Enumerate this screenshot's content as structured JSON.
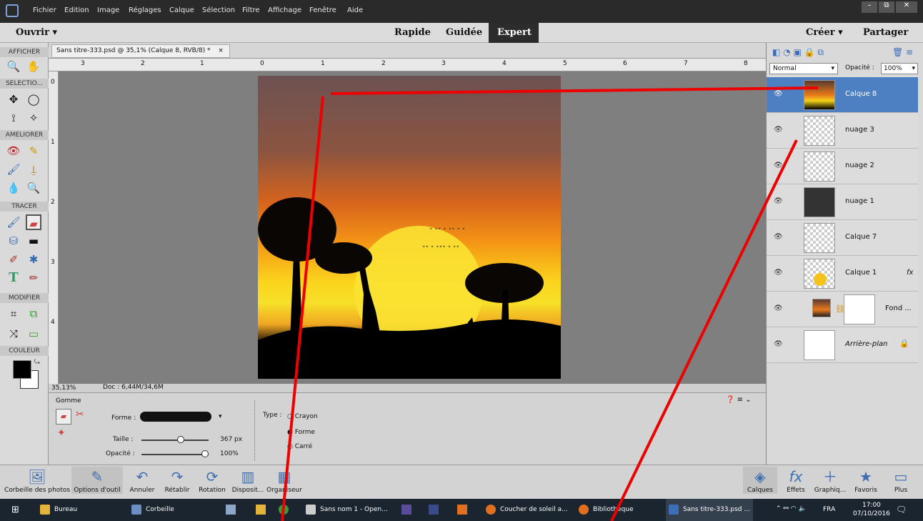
{
  "menu": {
    "items": [
      "Fichier",
      "Edition",
      "Image",
      "Réglages",
      "Calque",
      "Sélection",
      "Filtre",
      "Affichage",
      "Fenêtre",
      "Aide"
    ],
    "window_controls": [
      "–",
      "⧉",
      "✕"
    ]
  },
  "modebar": {
    "open_label": "Ouvrir",
    "modes": [
      "Rapide",
      "Guidée",
      "Expert"
    ],
    "active_mode": "Expert",
    "create_label": "Créer",
    "share_label": "Partager"
  },
  "toolbox": {
    "sections": [
      "AFFICHER",
      "SELECTIO...",
      "AMELIORER",
      "TRACER",
      "MODIFIER",
      "COULEUR"
    ]
  },
  "document": {
    "tab_title": "Sans titre-333.psd @ 35,1% (Calque 8, RVB/8) *",
    "tab_close": "×",
    "ruler_top": [
      "3",
      "2",
      "1",
      "0",
      "1",
      "2",
      "3",
      "4",
      "5",
      "6",
      "7",
      "8"
    ],
    "ruler_left": [
      "0",
      "1",
      "2",
      "3",
      "4"
    ],
    "zoom": "35,13%",
    "doc_info": "Doc : 6,44M/34,6M"
  },
  "options": {
    "tool_name": "Gomme",
    "forme_label": "Forme :",
    "taille_label": "Taille :",
    "taille_value": "367 px",
    "taille_fraction": 0.6,
    "opacite_label": "Opacité :",
    "opacite_value": "100%",
    "opacite_fraction": 1.0,
    "type_label": "Type :",
    "type_options": [
      "Crayon",
      "Forme",
      "Carré"
    ]
  },
  "layers_panel": {
    "blend_mode": "Normal",
    "opacity_label": "Opacité :",
    "opacity_value": "100%",
    "layers": [
      {
        "name": "Calque 8",
        "selected": true,
        "fx": ""
      },
      {
        "name": "nuage 3",
        "selected": false,
        "fx": ""
      },
      {
        "name": "nuage 2",
        "selected": false,
        "fx": ""
      },
      {
        "name": "nuage 1",
        "selected": false,
        "fx": ""
      },
      {
        "name": "Calque 7",
        "selected": false,
        "fx": ""
      },
      {
        "name": "Calque 1",
        "selected": false,
        "fx": "fx"
      },
      {
        "name": "Fond ...",
        "selected": false,
        "fx": ""
      },
      {
        "name": "Arrière-plan",
        "selected": false,
        "fx": ""
      }
    ]
  },
  "bottombar": {
    "left": [
      "Corbeille des photos",
      "Options d'outil",
      "Annuler",
      "Rétablir",
      "Rotation",
      "Disposit...",
      "Organiseur"
    ],
    "right": [
      "Calques",
      "Effets",
      "Graphiq...",
      "Favoris",
      "Plus"
    ]
  },
  "taskbar": {
    "items": [
      "Bureau",
      "Corbeille",
      "Sans nom 1 - Open...",
      "Coucher de soleil a...",
      "Bibliothèque",
      "Sans titre-333.psd ..."
    ],
    "lang": "FRA",
    "time": "17:00",
    "date": "07/10/2016"
  },
  "colors": {
    "accent": "#3c77c9",
    "selected_layer": "#4d7fc3",
    "annotation": "#e00000"
  }
}
